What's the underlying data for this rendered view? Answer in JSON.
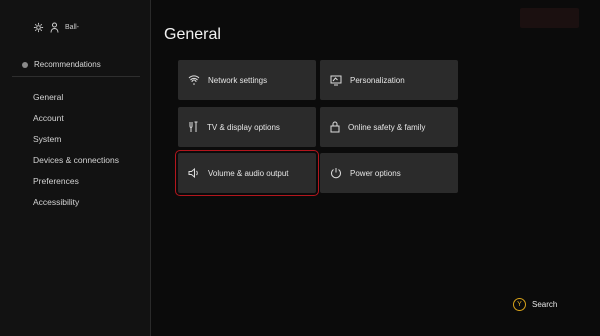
{
  "sidebar": {
    "user_name": "Ball-",
    "recommendations_label": "Recommendations",
    "nav": [
      {
        "label": "General"
      },
      {
        "label": "Account"
      },
      {
        "label": "System"
      },
      {
        "label": "Devices & connections"
      },
      {
        "label": "Preferences"
      },
      {
        "label": "Accessibility"
      }
    ]
  },
  "main": {
    "title": "General",
    "tiles": [
      {
        "label": "Network settings",
        "icon": "network-icon"
      },
      {
        "label": "Personalization",
        "icon": "personalization-icon"
      },
      {
        "label": "TV & display options",
        "icon": "tv-display-icon"
      },
      {
        "label": "Online safety & family",
        "icon": "lock-icon"
      },
      {
        "label": "Volume & audio output",
        "icon": "speaker-icon",
        "selected": true
      },
      {
        "label": "Power options",
        "icon": "power-icon"
      }
    ]
  },
  "footer": {
    "search_button_glyph": "Y",
    "search_label": "Search"
  },
  "colors": {
    "background": "#0b0b0b",
    "sidebar": "#121212",
    "tile": "#2b2b2b",
    "selection_outline": "#b3161d",
    "search_button_accent": "#e2b023"
  }
}
